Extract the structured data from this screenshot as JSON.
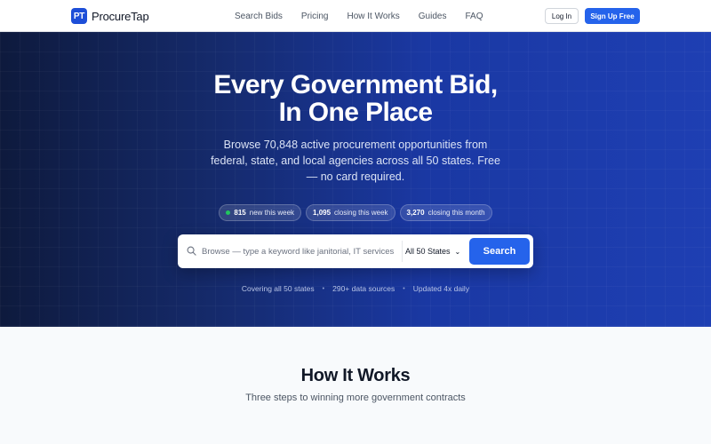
{
  "brand": {
    "mark": "PT",
    "name": "ProcureTap"
  },
  "nav": {
    "links": [
      "Search Bids",
      "Pricing",
      "How It Works",
      "Guides",
      "FAQ"
    ],
    "login_label": "Log In",
    "signup_label": "Sign Up Free"
  },
  "hero": {
    "title_line1": "Every Government Bid,",
    "title_line2": "In One Place",
    "subtitle": "Browse 70,848 active procurement opportunities from federal, state, and local agencies across all 50 states. Free — no card required.",
    "stats": [
      {
        "value": "815",
        "label": "new this week",
        "indicator": "green-dot"
      },
      {
        "value": "1,095",
        "label": "closing this week"
      },
      {
        "value": "3,270",
        "label": "closing this month"
      }
    ],
    "search": {
      "placeholder": "Browse — type a keyword like janitorial, IT services",
      "value": "",
      "state_selected": "All 50 States",
      "button_label": "Search"
    },
    "trust": [
      "Covering all 50 states",
      "290+ data sources",
      "Updated 4x daily"
    ]
  },
  "how": {
    "title": "How It Works",
    "subtitle": "Three steps to winning more government contracts"
  },
  "colors": {
    "accent": "#2563eb",
    "hero_dark": "#0e1a3d",
    "hero_blue": "#1e3fb3",
    "status_green": "#22c55e"
  }
}
